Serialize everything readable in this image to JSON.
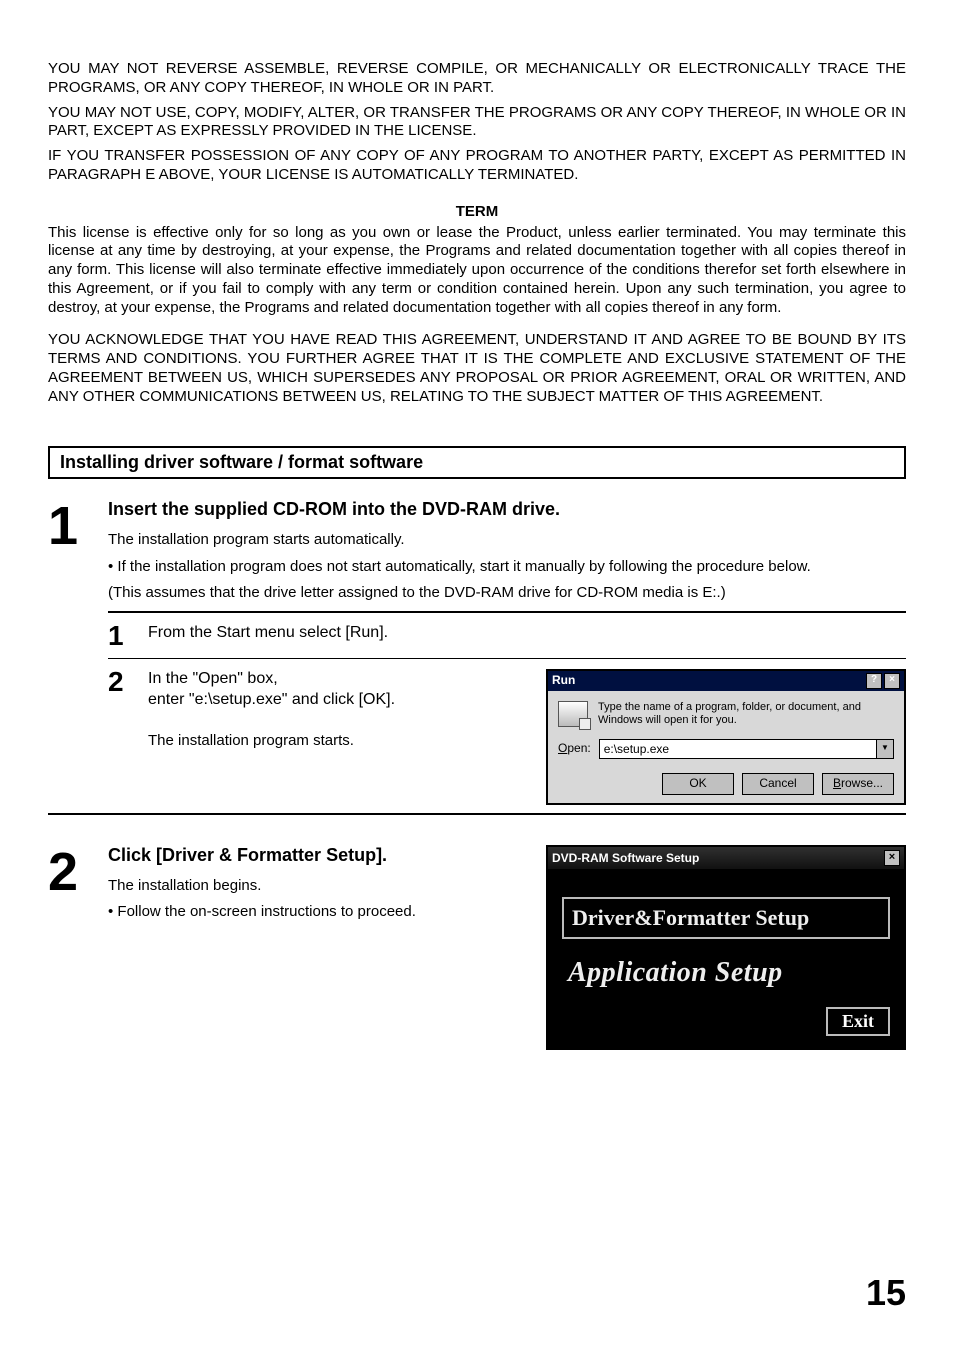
{
  "paragraphs": {
    "p1": "YOU MAY NOT REVERSE ASSEMBLE, REVERSE COMPILE, OR MECHANICALLY OR ELECTRONICALLY TRACE THE PROGRAMS, OR ANY COPY THEREOF, IN WHOLE OR IN PART.",
    "p2": "YOU MAY NOT USE, COPY, MODIFY, ALTER, OR TRANSFER THE PROGRAMS OR ANY COPY THEREOF, IN WHOLE OR IN PART, EXCEPT AS EXPRESSLY PROVIDED IN THE LICENSE.",
    "p3": "IF YOU TRANSFER POSSESSION OF ANY COPY OF ANY PROGRAM TO ANOTHER PARTY, EXCEPT AS PERMITTED IN PARAGRAPH E ABOVE, YOUR LICENSE IS AUTOMATICALLY TERMINATED.",
    "term_heading": "TERM",
    "term_body": "This license is effective only for so long as you own or lease the Product, unless earlier terminated. You may terminate this license at any time by destroying, at your expense, the Programs and related documentation together with all copies thereof in any form. This license will also terminate effective immediately upon occurrence of the conditions therefor set forth elsewhere in this Agreement, or if you fail to comply with any term or condition contained herein. Upon any such termination, you agree to destroy, at your expense, the Programs and related documentation together with all copies thereof in any form.",
    "ack": "YOU ACKNOWLEDGE THAT YOU HAVE READ THIS AGREEMENT, UNDERSTAND IT AND AGREE TO BE BOUND BY ITS TERMS AND CONDITIONS. YOU FURTHER AGREE THAT IT IS THE COMPLETE AND EXCLUSIVE STATEMENT OF THE AGREEMENT BETWEEN US, WHICH SUPERSEDES ANY PROPOSAL OR PRIOR AGREEMENT, ORAL OR WRITTEN, AND ANY OTHER COMMUNICATIONS BETWEEN US, RELATING TO THE SUBJECT MATTER OF THIS AGREEMENT."
  },
  "section_title": "Installing driver software / format software",
  "step1": {
    "num": "1",
    "title": "Insert the supplied CD-ROM into the DVD-RAM drive.",
    "line1": "The installation program starts automatically.",
    "bullet": "If the installation program does not start automatically, start it manually by following the procedure below.",
    "note": "(This assumes that the drive letter assigned to the DVD-RAM drive for CD-ROM media is E:.)",
    "sub1": {
      "num": "1",
      "text": "From the Start menu select [Run]."
    },
    "sub2": {
      "num": "2",
      "line1": "In the \"Open\" box,",
      "line2": "enter \"e:\\setup.exe\" and click [OK].",
      "line3": "The installation program starts."
    }
  },
  "run_dialog": {
    "title": "Run",
    "help_btn": "?",
    "close_btn": "×",
    "description": "Type the name of a program, folder, or document, and Windows will open it for you.",
    "open_label": "Open:",
    "open_value": "e:\\setup.exe",
    "dropdown_btn": "▼",
    "ok": "OK",
    "cancel": "Cancel",
    "browse": "Browse..."
  },
  "step2": {
    "num": "2",
    "title": "Click [Driver & Formatter Setup].",
    "line1": "The installation begins.",
    "bullet": "Follow the on-screen instructions to proceed."
  },
  "setup_dialog": {
    "title": "DVD-RAM Software Setup",
    "close_btn": "×",
    "option1": "Driver&Formatter Setup",
    "option2": "Application Setup",
    "exit": "Exit"
  },
  "page_number": "15"
}
